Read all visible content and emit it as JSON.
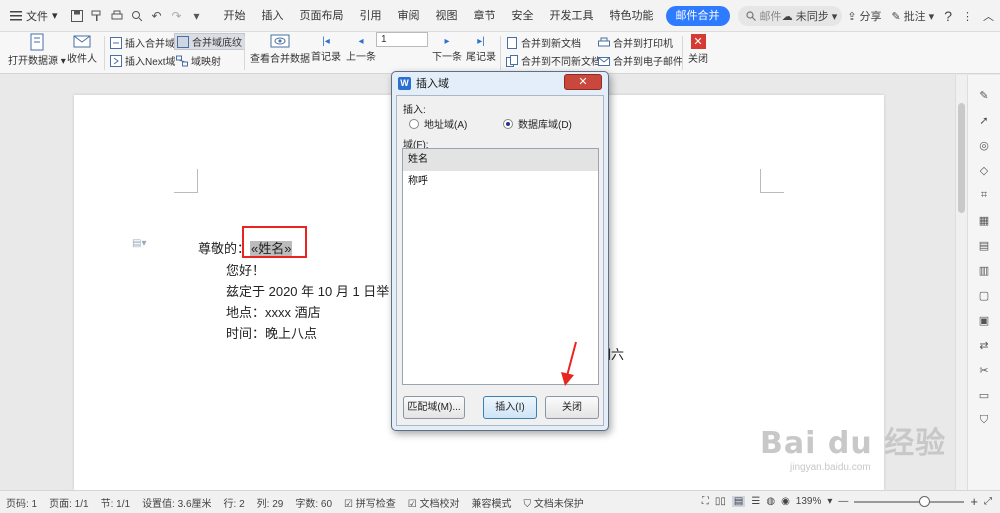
{
  "menu": {
    "file_label": "文件"
  },
  "tabs": [
    {
      "label": "开始",
      "active": false
    },
    {
      "label": "插入",
      "active": false
    },
    {
      "label": "页面布局",
      "active": false
    },
    {
      "label": "引用",
      "active": false
    },
    {
      "label": "审阅",
      "active": false
    },
    {
      "label": "视图",
      "active": false
    },
    {
      "label": "章节",
      "active": false
    },
    {
      "label": "安全",
      "active": false
    },
    {
      "label": "开发工具",
      "active": false
    },
    {
      "label": "特色功能",
      "active": false
    },
    {
      "label": "邮件合并",
      "active": true
    }
  ],
  "search": {
    "value": "邮件"
  },
  "topright": {
    "sync": "未同步",
    "share": "分享",
    "annotate": "批注",
    "help": "?"
  },
  "ribbon": {
    "open_datasource": "打开数据源",
    "recipients": "收件人",
    "insert_merge_field": "插入合并域",
    "merge_field_shading": "合并域底纹",
    "insert_next_field": "插入Next域",
    "field_mapping": "域映射",
    "view_merged_data": "查看合并数据",
    "first_record": "首记录",
    "prev_record": "上一条",
    "record_number": "1",
    "next_record": "下一条",
    "last_record": "尾记录",
    "merge_to_new_doc": "合并到新文档",
    "merge_to_diff_docs": "合并到不同新文档",
    "merge_to_printer": "合并到打印机",
    "merge_to_email": "合并到电子邮件",
    "close": "关闭"
  },
  "document": {
    "greeting_prefix": "尊敬的：",
    "merge_field": "«姓名»",
    "line2": "您好！",
    "line3": "兹定于 2020 年 10 月 1 日举",
    "line3_tail": "期六",
    "line4": "地点：xxxx 酒店",
    "line5": "时间：晚上八点"
  },
  "dialog": {
    "title": "插入域",
    "insert_label": "插入:",
    "radio_address": "地址域(A)",
    "radio_database": "数据库域(D)",
    "selected_radio": "database",
    "fields_label": "域(F):",
    "fields": [
      "姓名",
      "称呼"
    ],
    "selected_field": "姓名",
    "match_button": "匹配域(M)...",
    "insert_button": "插入(I)",
    "close_button": "关闭"
  },
  "statusbar": {
    "page_num": "页码: 1",
    "pages": "页面: 1/1",
    "section": "节: 1/1",
    "setting": "设置值: 3.6厘米",
    "row": "行: 2",
    "col": "列: 29",
    "words": "字数: 60",
    "spellcheck": "拼写检查",
    "proofread": "文档校对",
    "compat": "兼容模式",
    "protect": "文档未保护",
    "zoom": "139%"
  },
  "watermark": {
    "big": "Bai du 经验",
    "small": "jingyan.baidu.com"
  },
  "colors": {
    "accent": "#2f7bff",
    "highlight_border": "#e8261f",
    "arrow": "#e8261f"
  }
}
